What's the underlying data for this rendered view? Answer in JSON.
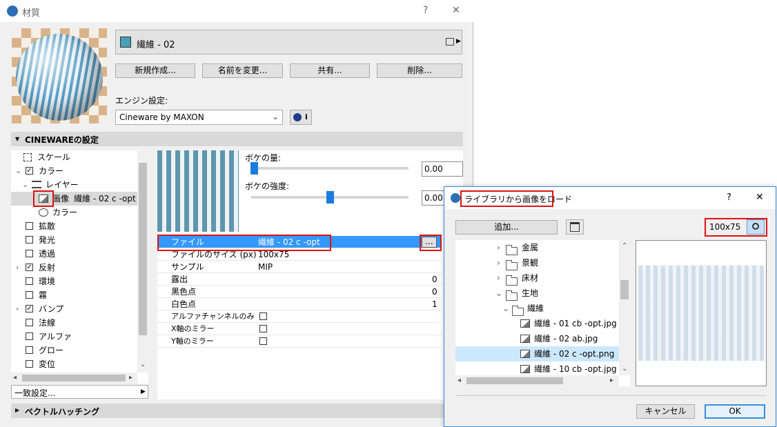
{
  "window": {
    "title": "材質",
    "help": "?",
    "close": "✕"
  },
  "material": {
    "name": "繊維 - 02",
    "swatch_color": "#4a9fb8"
  },
  "buttons": {
    "new": "新規作成...",
    "rename": "名前を変更...",
    "share": "共有...",
    "delete": "削除..."
  },
  "engine": {
    "label": "エンジン設定:",
    "value": "Cineware by MAXON"
  },
  "sections": {
    "cineware": "CINEWAREの設定",
    "vector": "ベクトルハッチング"
  },
  "tree": {
    "items": [
      {
        "label": "スケール"
      },
      {
        "label": "カラー"
      },
      {
        "label": "レイヤー"
      },
      {
        "label": "画像",
        "value": "繊維 - 02 c -opt"
      },
      {
        "label": "カラー"
      },
      {
        "label": "拡散"
      },
      {
        "label": "発光"
      },
      {
        "label": "透過"
      },
      {
        "label": "反射"
      },
      {
        "label": "環境"
      },
      {
        "label": "霧"
      },
      {
        "label": "バンプ"
      },
      {
        "label": "法線"
      },
      {
        "label": "アルファ"
      },
      {
        "label": "グロー"
      },
      {
        "label": "変位"
      }
    ]
  },
  "match_settings": "一致設定...",
  "bokeh": {
    "amount_label": "ボケの量:",
    "amount_value": "0.00",
    "amount_level": 0.02,
    "strength_label": "ボケの強度:",
    "strength_value": "0.00",
    "strength_level": 0.5
  },
  "props": {
    "rows": [
      {
        "label": "ファイル",
        "value": "繊維 - 02 c -opt"
      },
      {
        "label": "ファイルのサイズ (px)",
        "value": "100x75"
      },
      {
        "label": "サンプル",
        "value": "MIP"
      },
      {
        "label": "露出",
        "value": "0"
      },
      {
        "label": "黒色点",
        "value": "0"
      },
      {
        "label": "白色点",
        "value": "1"
      },
      {
        "label": "アルファチャンネルのみ",
        "value": ""
      },
      {
        "label": "X軸のミラー",
        "value": ""
      },
      {
        "label": "Y軸のミラー",
        "value": ""
      }
    ],
    "browse": "..."
  },
  "dialog": {
    "title": "ライブラリから画像をロード",
    "help": "?",
    "close": "✕",
    "add": "追加...",
    "size": "100x75",
    "cancel": "キャンセル",
    "ok": "OK",
    "files": [
      {
        "label": "金属"
      },
      {
        "label": "景観"
      },
      {
        "label": "床材"
      },
      {
        "label": "生地"
      },
      {
        "label": "繊維"
      },
      {
        "label": "繊維 - 01 cb -opt.jpg"
      },
      {
        "label": "繊維 - 02 ab.jpg"
      },
      {
        "label": "繊維 - 02 c -opt.png"
      },
      {
        "label": "繊維 - 10 cb -opt.jpg"
      }
    ]
  },
  "colors": {
    "accent": "#3399ff",
    "highlight_red": "#e01010",
    "selected_row": "#cce8ff"
  }
}
